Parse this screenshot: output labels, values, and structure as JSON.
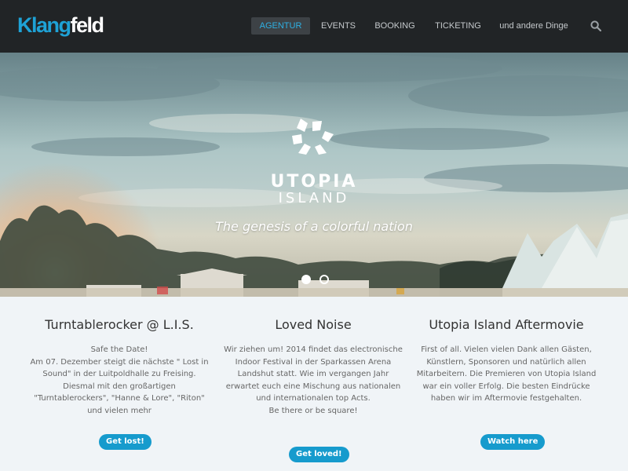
{
  "brand": {
    "logo_part1": "Klang",
    "logo_part2": "feld",
    "accent": "#1ea2d6"
  },
  "nav": {
    "items": [
      {
        "label": "AGENTUR",
        "active": true
      },
      {
        "label": "EVENTS",
        "active": false
      },
      {
        "label": "BOOKING",
        "active": false
      },
      {
        "label": "TICKETING",
        "active": false
      },
      {
        "label": "und andere Dinge",
        "active": false
      }
    ],
    "search_icon": "search-icon"
  },
  "hero": {
    "title_line1": "UTOPIA",
    "title_line2": "ISLAND",
    "tagline": "The genesis of a colorful nation",
    "slides": [
      {
        "active": true
      },
      {
        "active": false
      }
    ]
  },
  "columns": [
    {
      "title": "Turntablerocker @ L.I.S.",
      "text": [
        "Safe the Date!",
        "Am 07. Dezember steigt die nächste \" Lost in Sound\" in der Luitpoldhalle zu Freising. Diesmal mit den großartigen \"Turntablerockers\", \"Hanne & Lore\", \"Riton\" und vielen mehr"
      ],
      "button": "Get lost!"
    },
    {
      "title": "Loved Noise",
      "text": [
        "Wir ziehen um! 2014 findet das electronische Indoor Festival in der Sparkassen Arena Landshut statt. Wie im vergangen Jahr erwartet euch eine Mischung aus nationalen und internationalen top Acts.",
        "Be there or be square!"
      ],
      "button": "Get loved!"
    },
    {
      "title": "Utopia Island Aftermovie",
      "text": [
        "First of all. Vielen vielen Dank allen Gästen, Künstlern, Sponsoren und natürlich allen Mitarbeitern. Die Premieren von Utopia Island war ein voller Erfolg. Die besten Eindrücke haben wir im Aftermovie festgehalten."
      ],
      "button": "Watch here"
    }
  ]
}
